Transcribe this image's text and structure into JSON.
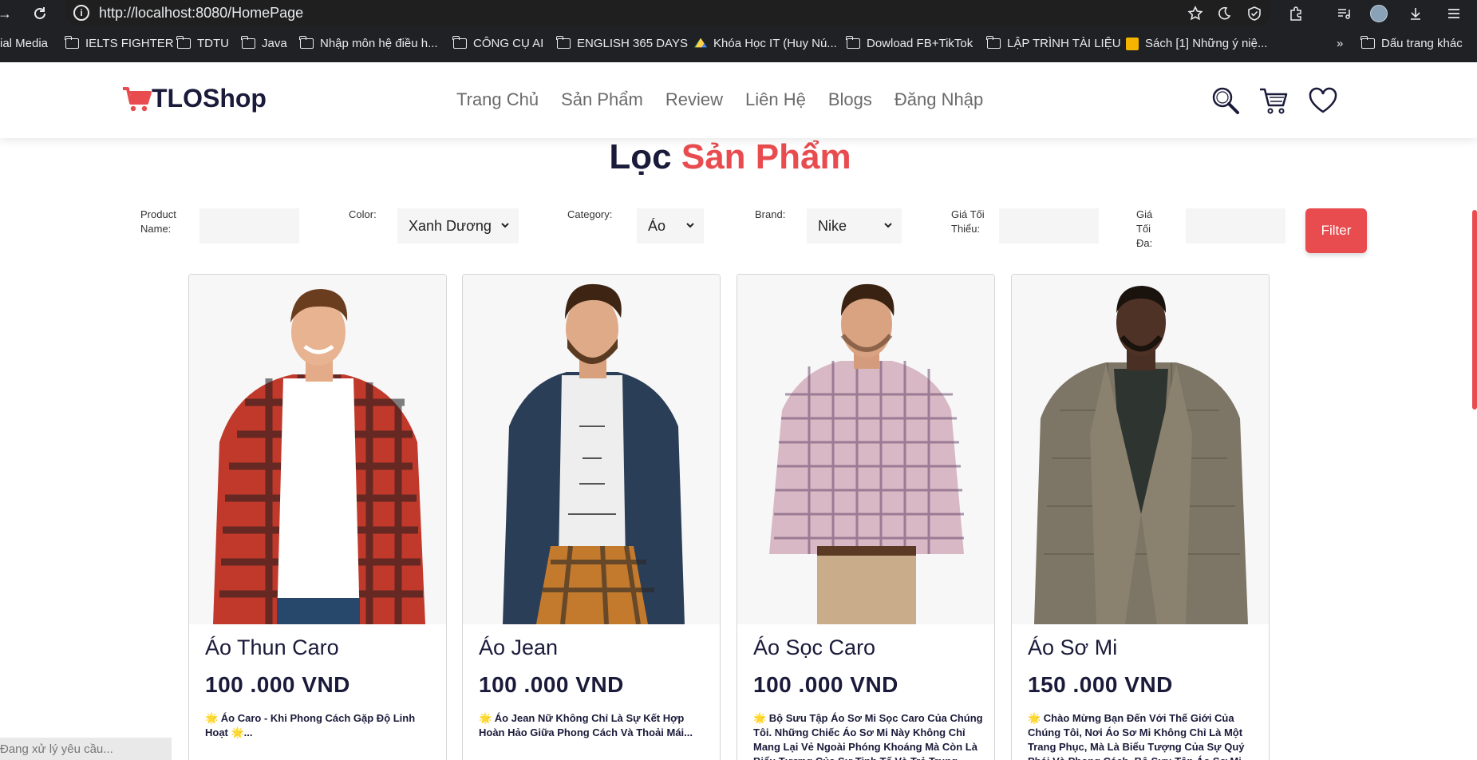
{
  "browser": {
    "url": "http://localhost:8080/HomePage",
    "bookmarks": [
      {
        "label": "ial Media",
        "icon": "none"
      },
      {
        "label": "IELTS FIGHTER",
        "icon": "folder-icon"
      },
      {
        "label": "TDTU",
        "icon": "folder-icon"
      },
      {
        "label": "Java",
        "icon": "folder-icon"
      },
      {
        "label": "Nhập môn hệ điều h...",
        "icon": "folder-icon"
      },
      {
        "label": "CÔNG CỤ AI",
        "icon": "folder-icon"
      },
      {
        "label": "ENGLISH 365 DAYS",
        "icon": "folder-icon"
      },
      {
        "label": "Khóa Học IT (Huy Nú...",
        "icon": "drive-icon"
      },
      {
        "label": "Dowload FB+TikTok",
        "icon": "folder-icon"
      },
      {
        "label": "LẬP TRÌNH TÀI LIỆU",
        "icon": "folder-icon"
      },
      {
        "label": "Sách [1] Những ý niệ...",
        "icon": "sheet-icon"
      }
    ],
    "overflow": "»",
    "other_bookmarks": "Dấu trang khác"
  },
  "header": {
    "logo_text": "TLOShop",
    "menu": [
      "Trang Chủ",
      "Sản Phẩm",
      "Review",
      "Liên Hệ",
      "Blogs",
      "Đăng Nhập"
    ]
  },
  "title": {
    "part1": "Lọc",
    "part2": "Sản Phẩm"
  },
  "filter": {
    "product_name_label": "Product Name:",
    "product_name_value": "",
    "color_label": "Color:",
    "color_value": "Xanh Dương",
    "category_label": "Category:",
    "category_value": "Áo",
    "brand_label": "Brand:",
    "brand_value": "Nike",
    "min_price_label": "Giá Tối Thiểu:",
    "min_price_value": "",
    "max_price_label": "Giá Tối Đa:",
    "max_price_value": "",
    "button": "Filter"
  },
  "products": [
    {
      "name": "Áo Thun Caro",
      "price": "100 .000 VND",
      "desc": "🌟 Áo Caro - Khi Phong Cách Gặp Độ Linh Hoạt 🌟..."
    },
    {
      "name": "Áo Jean",
      "price": "100 .000 VND",
      "desc": "🌟 Áo Jean Nữ Không Chỉ Là Sự Kết Hợp Hoàn Hảo Giữa Phong Cách Và Thoải Mái..."
    },
    {
      "name": "Áo Sọc Caro",
      "price": "100 .000 VND",
      "desc": "🌟 Bộ Sưu Tập Áo Sơ Mi Sọc Caro Của Chúng Tôi. Những Chiếc Áo Sơ Mi Này Không Chỉ Mang Lại Vẻ Ngoài Phóng Khoáng Mà Còn Là Biểu Tượng Của Sự Tinh Tế Và Trẻ Trung."
    },
    {
      "name": "Áo Sơ Mi",
      "price": "150 .000 VND",
      "desc": "🌟 Chào Mừng Bạn Đến Với Thế Giới Của Chúng Tôi, Nơi Áo Sơ Mi Không Chỉ Là Một Trang Phục, Mà Là Biểu Tượng Của Sự Quý Phái Và Phong Cách. Bộ Sưu Tập Áo Sơ Mi Nữ"
    }
  ],
  "status": "Đang xử lý yêu cầu...",
  "colors": {
    "accent": "#e84c4f",
    "dark": "#1a1a3a",
    "chrome": "#202124"
  }
}
